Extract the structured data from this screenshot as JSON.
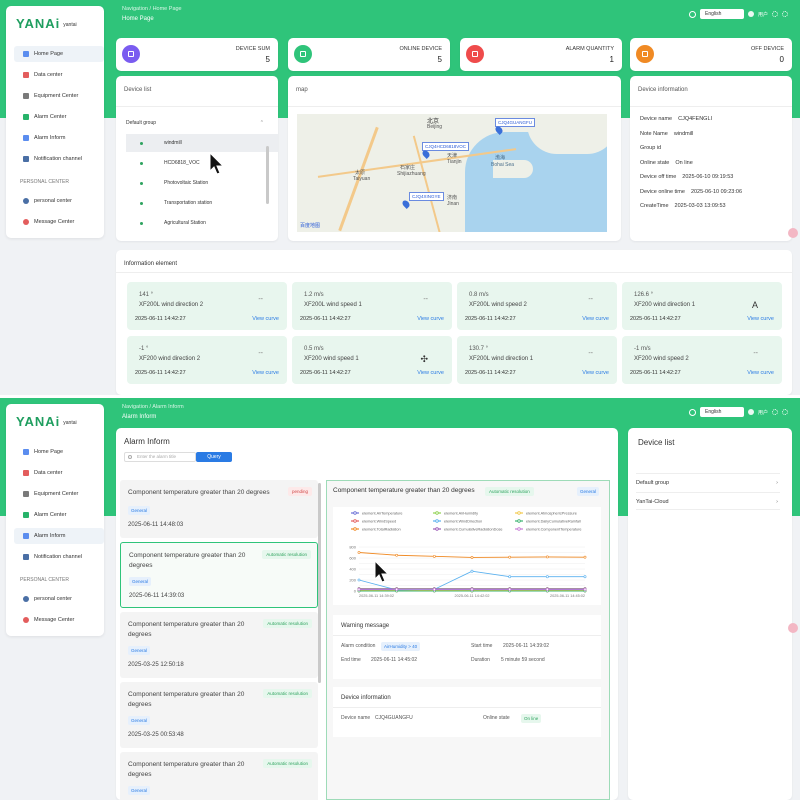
{
  "brand": {
    "logo": "YANAi",
    "logo_sub": "yantai"
  },
  "top": {
    "breadcrumb": "Navigation  /  Home Page",
    "page_title": "Home Page",
    "language": "English",
    "user": "用户"
  },
  "bottom": {
    "breadcrumb": "Navigation  /  Alarm Inform",
    "page_title": "Alarm Inform",
    "language": "English",
    "user": "用户"
  },
  "nav": [
    {
      "label": "Home Page",
      "icon": "monitor-icon",
      "color": "#5b8def"
    },
    {
      "label": "Data center",
      "icon": "chart-icon",
      "color": "#e35d5d"
    },
    {
      "label": "Equipment Center",
      "icon": "gear-icon",
      "color": "#7a7a7a"
    },
    {
      "label": "Alarm Center",
      "icon": "bell-icon",
      "color": "#27b36a"
    },
    {
      "label": "Alarm Inform",
      "icon": "alarm-icon",
      "color": "#5b8def"
    },
    {
      "label": "Notification channel",
      "icon": "mail-icon",
      "color": "#4a6fa5"
    }
  ],
  "personal_label": "PERSONAL CENTER",
  "personal": [
    {
      "label": "personal center",
      "icon": "person-icon",
      "color": "#4a6fa5"
    },
    {
      "label": "Message Center",
      "icon": "message-icon",
      "color": "#e35d5d"
    }
  ],
  "stats": [
    {
      "label": "DEVICE SUM",
      "value": "5",
      "color": "#7a5cf0"
    },
    {
      "label": "ONLINE DEVICE",
      "value": "5",
      "color": "#2fc47a"
    },
    {
      "label": "ALARM QUANTITY",
      "value": "1",
      "color": "#ef4b4b"
    },
    {
      "label": "OFF DEVICE",
      "value": "0",
      "color": "#f08a24"
    }
  ],
  "device_list": {
    "title": "Device list",
    "group": "Default group",
    "devices": [
      "windmill",
      "HCD6818_VOC",
      "Photovoltaic Station",
      "Transportation station",
      "Agricultural Station"
    ]
  },
  "map": {
    "title": "map",
    "markers": [
      "CJQ4GUANGFU",
      "CJQ4HCD6818VOC",
      "CJQ4XINGYE"
    ],
    "cities": [
      "北京",
      "Beijing",
      "天津",
      "Tianjin",
      "石家庄",
      "Shijiazhuang",
      "太原",
      "Taiyuan",
      "济南",
      "Jinan",
      "渤海",
      "Bohai Sea"
    ],
    "attribution": "百度地图"
  },
  "device_info": {
    "title": "Device information",
    "rows": [
      {
        "k": "Device name",
        "v": "CJQ4FENGLI"
      },
      {
        "k": "Note Name",
        "v": "windmill"
      },
      {
        "k": "Group id",
        "v": ""
      },
      {
        "k": "Online state",
        "v": "On line"
      },
      {
        "k": "Device off time",
        "v": "2025-06-10 09:19:53"
      },
      {
        "k": "Device online time",
        "v": "2025-06-10 09:23:06"
      },
      {
        "k": "CreateTime",
        "v": "2025-03-03 13:09:53"
      }
    ]
  },
  "info_element": {
    "title": "Information element",
    "tiles": [
      {
        "value": "141 °",
        "name": "XF200L wind direction 2",
        "time": "2025-06-11 14:42:27",
        "link": "View curve",
        "sym": "--"
      },
      {
        "value": "1.2 m/s",
        "name": "XF200L wind speed 1",
        "time": "2025-06-11 14:42:27",
        "link": "View curve",
        "sym": "--"
      },
      {
        "value": "0.8 m/s",
        "name": "XF200L wind speed 2",
        "time": "2025-06-11 14:42:27",
        "link": "View curve",
        "sym": "--"
      },
      {
        "value": "126.6 °",
        "name": "XF200 wind direction 1",
        "time": "2025-06-11 14:42:27",
        "link": "View curve",
        "sym": "A"
      },
      {
        "value": "-1 °",
        "name": "XF200 wind direction 2",
        "time": "2025-06-11 14:42:27",
        "link": "View curve",
        "sym": "--"
      },
      {
        "value": "0.5 m/s",
        "name": "XF200 wind speed 1",
        "time": "2025-06-11 14:42:27",
        "link": "View curve",
        "sym": "✣"
      },
      {
        "value": "130.7 °",
        "name": "XF200L wind direction 1",
        "time": "2025-06-11 14:42:27",
        "link": "View curve",
        "sym": "--"
      },
      {
        "value": "-1 m/s",
        "name": "XF200 wind speed 2",
        "time": "2025-06-11 14:42:27",
        "link": "View curve",
        "sym": "--"
      }
    ]
  },
  "alarm_inform": {
    "title": "Alarm Inform",
    "search_placeholder": "Enter the alarm title",
    "query": "Query",
    "items": [
      {
        "title": "Component temperature greater than 20 degrees",
        "status": "pending",
        "kind": "pend",
        "tag": "General",
        "time": "2025-06-11 14:48:03"
      },
      {
        "title": "Component temperature greater than 20 degrees",
        "status": "Automatic resolution",
        "kind": "auto",
        "tag": "General",
        "time": "2025-06-11 14:39:03"
      },
      {
        "title": "Component temperature greater than 20 degrees",
        "status": "Automatic resolution",
        "kind": "auto",
        "tag": "General",
        "time": "2025-03-25 12:50:18"
      },
      {
        "title": "Component temperature greater than 20 degrees",
        "status": "Automatic resolution",
        "kind": "auto",
        "tag": "General",
        "time": "2025-03-25 00:53:48"
      },
      {
        "title": "Component temperature greater than 20 degrees",
        "status": "Automatic resolution",
        "kind": "auto",
        "tag": "General",
        "time": ""
      }
    ]
  },
  "detail": {
    "title": "Component temperature greater than 20 degrees",
    "status": "Automatic resolution",
    "tag": "General",
    "warning_title": "Warning message",
    "alarm_condition_label": "Alarm condition",
    "alarm_condition_value": "AirHumidity > 40",
    "start_label": "Start time",
    "start_value": "2025-06-11 14:39:02",
    "end_label": "End time",
    "end_value": "2025-06-11 14:45:02",
    "duration_label": "Duration",
    "duration_value": "5 minute 59 second",
    "device_title": "Device information",
    "device_name_label": "Device name",
    "device_name_value": "CJQ4GUANGFU",
    "online_label": "Online state",
    "online_value": "On line"
  },
  "right_device_list": {
    "title": "Device list",
    "groups": [
      "Default group",
      "YanTai-Cloud"
    ]
  },
  "chart_data": {
    "type": "line",
    "x": [
      "2025-06-11 14:39:02",
      "2025-06-11 14:40",
      "2025-06-11 14:41",
      "2025-06-11 14:42:02",
      "2025-06-11 14:43",
      "2025-06-11 14:44",
      "2025-06-11 14:45:02"
    ],
    "ylim": [
      0,
      800
    ],
    "yticks": [
      0,
      100,
      200,
      300,
      400,
      500,
      600,
      700,
      800
    ],
    "xticks": [
      "2025-06-11 14:39:02",
      "2025-06-11 14:42:02",
      "2025-06-11 14:45:02"
    ],
    "series": [
      {
        "name": "element.AirTemperature",
        "color": "#6a6fd6",
        "values": [
          22,
          22,
          22,
          22,
          22,
          22,
          22
        ]
      },
      {
        "name": "element.AirHumidity",
        "color": "#8fd14f",
        "values": [
          45,
          45,
          45,
          45,
          45,
          45,
          45
        ]
      },
      {
        "name": "element.AtmosphericPressure",
        "color": "#f2c94c",
        "values": [
          10,
          10,
          10,
          10,
          10,
          10,
          10
        ]
      },
      {
        "name": "element.WindSpeed",
        "color": "#e35d5d",
        "values": [
          1,
          1,
          1,
          1,
          1,
          1,
          1
        ]
      },
      {
        "name": "element.WindDirection",
        "color": "#5ab1ef",
        "values": [
          200,
          20,
          30,
          360,
          260,
          260,
          260
        ]
      },
      {
        "name": "element.DailyCumulativeRainfall",
        "color": "#3cb371",
        "values": [
          0,
          0,
          0,
          0,
          0,
          0,
          0
        ]
      },
      {
        "name": "element.TotalRadiation",
        "color": "#f08a24",
        "values": [
          700,
          650,
          630,
          610,
          615,
          620,
          615
        ]
      },
      {
        "name": "element.CumulativeRadiationDose",
        "color": "#9b59b6",
        "values": [
          40,
          40,
          40,
          40,
          40,
          40,
          40
        ]
      },
      {
        "name": "element.ComponentTemperature",
        "color": "#c77dd6",
        "values": [
          30,
          30,
          30,
          30,
          30,
          30,
          30
        ]
      }
    ]
  }
}
